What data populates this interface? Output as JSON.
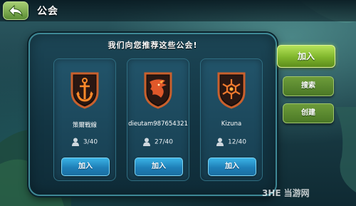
{
  "header": {
    "title": "公会"
  },
  "panel": {
    "heading": "我们向您推荐这些公会!"
  },
  "guilds": [
    {
      "name": "策爾戰線",
      "members": "3/40",
      "join_label": "加入",
      "emblem": "anchor-emblem",
      "color": "#e6572a"
    },
    {
      "name": "dieutam987654321",
      "members": "27/40",
      "join_label": "加入",
      "emblem": "dragon-emblem",
      "color": "#d1462a"
    },
    {
      "name": "Kizuna",
      "members": "12/40",
      "join_label": "加入",
      "emblem": "snowflake-emblem",
      "color": "#e0602e"
    }
  ],
  "side_buttons": {
    "join": "加入",
    "search": "搜索",
    "create": "创建"
  },
  "watermark": {
    "logo": "3HE",
    "site": "当游网"
  },
  "colors": {
    "accent_green": "#7fb52c",
    "join_blue": "#1f7fb8",
    "panel": "#133543"
  }
}
